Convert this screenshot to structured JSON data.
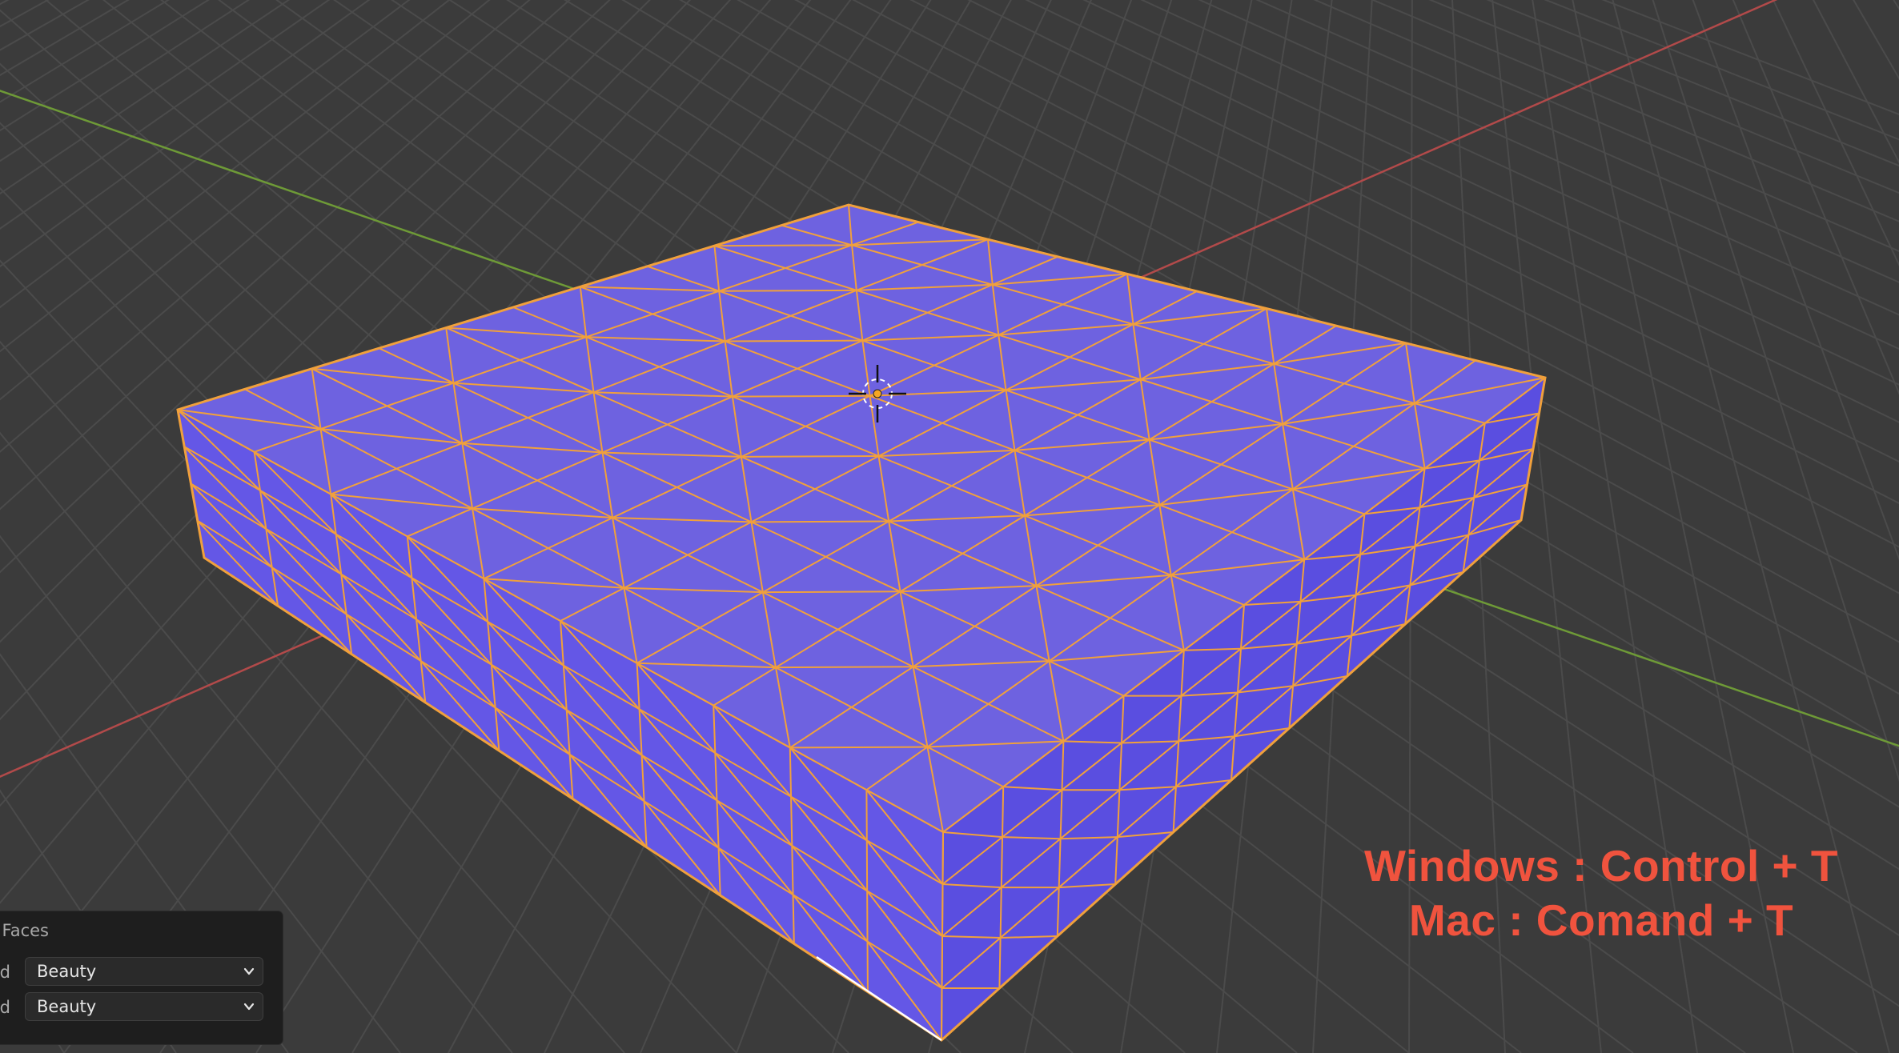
{
  "viewport": {
    "background": "#3b3b3b",
    "grid_color": "#4b4b4b",
    "x_axis_color": "#b24a4a",
    "y_axis_color": "#6e9a37"
  },
  "mesh": {
    "face_color": "#6e62e0",
    "side_color_front": "#6457e6",
    "side_color_right": "#5a4ee0",
    "edge_color": "#f0a03c",
    "origin_color": "#f5a623",
    "wireframe": "triangulated"
  },
  "overlay": {
    "line1": "Windows : Control + T",
    "line2": "Mac : Comand + T",
    "color": "#f0533e"
  },
  "operator_panel": {
    "title": "Triangulate Faces",
    "rows": [
      {
        "label": "Quad Method",
        "value": "Beauty",
        "icon": "chevron-down-icon"
      },
      {
        "label": "N-gon Method",
        "value": "Beauty",
        "icon": "chevron-down-icon"
      }
    ]
  }
}
